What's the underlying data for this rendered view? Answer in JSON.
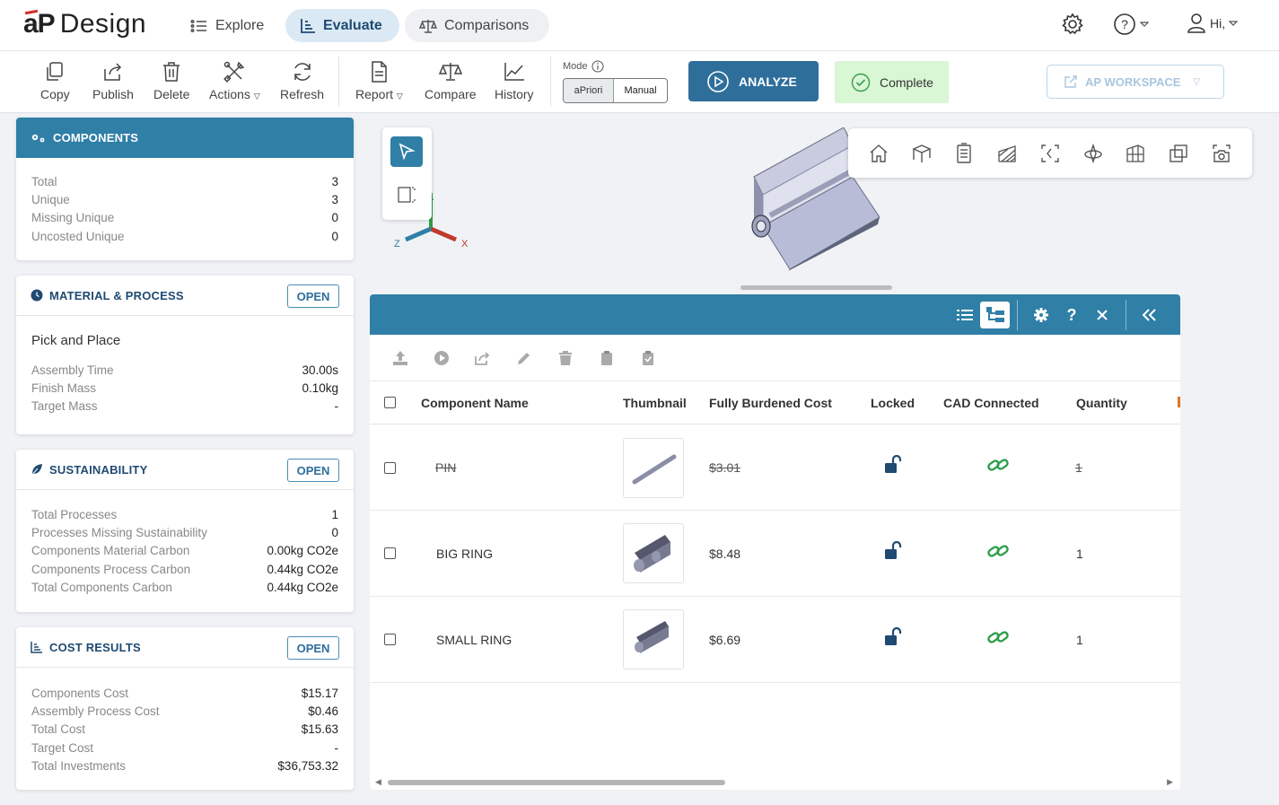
{
  "app": {
    "logo_ap": "aP",
    "logo_design": "Design"
  },
  "nav": {
    "explore": "Explore",
    "evaluate": "Evaluate",
    "comparisons": "Comparisons",
    "greeting": "Hi,"
  },
  "toolbar": {
    "copy": "Copy",
    "publish": "Publish",
    "delete": "Delete",
    "actions": "Actions",
    "refresh": "Refresh",
    "report": "Report",
    "compare": "Compare",
    "history": "History",
    "mode_label": "Mode",
    "mode_apriori": "aPriori",
    "mode_manual": "Manual",
    "analyze": "ANALYZE",
    "status": "Complete",
    "workspace": "AP WORKSPACE"
  },
  "components_panel": {
    "title": "COMPONENTS",
    "rows": [
      {
        "label": "Total",
        "value": "3"
      },
      {
        "label": "Unique",
        "value": "3"
      },
      {
        "label": "Missing Unique",
        "value": "0"
      },
      {
        "label": "Uncosted Unique",
        "value": "0"
      }
    ]
  },
  "material_panel": {
    "title": "MATERIAL & PROCESS",
    "open": "OPEN",
    "subtitle": "Pick and Place",
    "rows": [
      {
        "label": "Assembly Time",
        "value": "30.00s"
      },
      {
        "label": "Finish Mass",
        "value": "0.10kg"
      },
      {
        "label": "Target Mass",
        "value": "-"
      }
    ]
  },
  "sustainability_panel": {
    "title": "SUSTAINABILITY",
    "open": "OPEN",
    "rows": [
      {
        "label": "Total Processes",
        "value": "1"
      },
      {
        "label": "Processes Missing Sustainability",
        "value": "0"
      },
      {
        "label": "Components Material Carbon",
        "value": "0.00kg CO2e"
      },
      {
        "label": "Components Process Carbon",
        "value": "0.44kg CO2e"
      },
      {
        "label": "Total Components Carbon",
        "value": "0.44kg CO2e"
      }
    ]
  },
  "cost_panel": {
    "title": "COST RESULTS",
    "open": "OPEN",
    "rows": [
      {
        "label": "Components Cost",
        "value": "$15.17"
      },
      {
        "label": "Assembly Process Cost",
        "value": "$0.46"
      },
      {
        "label": "Total Cost",
        "value": "$15.63"
      },
      {
        "label": "Target Cost",
        "value": "-"
      },
      {
        "label": "Total Investments",
        "value": "$36,753.32"
      }
    ]
  },
  "viewer": {
    "axis_x": "X",
    "axis_z": "Z"
  },
  "table": {
    "headers": {
      "name": "Component Name",
      "thumbnail": "Thumbnail",
      "cost": "Fully Burdened Cost",
      "locked": "Locked",
      "cad": "CAD Connected",
      "quantity": "Quantity"
    },
    "rows": [
      {
        "name": "PIN",
        "cost": "$3.01",
        "quantity": "1"
      },
      {
        "name": "BIG RING",
        "cost": "$8.48",
        "quantity": "1"
      },
      {
        "name": "SMALL RING",
        "cost": "$6.69",
        "quantity": "1"
      }
    ]
  },
  "colors": {
    "header_blue": "#2f7fa6",
    "analyze_blue": "#2e6e9b",
    "complete_green": "#d9f6d5",
    "link_green": "#2e9e4a",
    "lock_navy": "#1f4a72"
  }
}
